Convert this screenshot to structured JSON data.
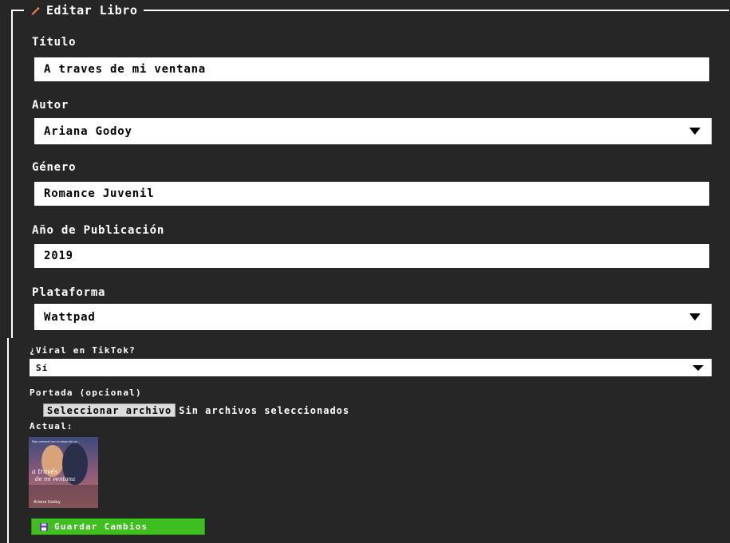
{
  "form": {
    "legend": "Editar Libro",
    "legend_icon": "pencil-icon",
    "fields": {
      "titulo": {
        "label": "Título",
        "value": "A traves de mi ventana"
      },
      "autor": {
        "label": "Autor",
        "value": "Ariana Godoy"
      },
      "genero": {
        "label": "Género",
        "value": "Romance Juvenil"
      },
      "anio": {
        "label": "Año de Publicación",
        "value": "2019"
      },
      "plataforma": {
        "label": "Plataforma",
        "value": "Wattpad"
      },
      "viral": {
        "label": "¿Viral en TikTok?",
        "value": "Sí"
      },
      "portada": {
        "label": "Portada (opcional)",
        "button_label": "Seleccionar archivo",
        "status": "Sin archivos seleccionados"
      }
    },
    "current_label": "Actual:",
    "cover_image": {
      "title_line1": "a través",
      "title_line2": "de mi ventana",
      "author": "Ariana Godoy",
      "top_text": "Todo comenzó con un deseo del sol..."
    },
    "save_button": {
      "label": "Guardar Cambios",
      "icon": "floppy-disk-icon"
    }
  },
  "colors": {
    "background": "#262626",
    "save_button": "#3fbf1f",
    "pencil": "#ff7a3d"
  }
}
